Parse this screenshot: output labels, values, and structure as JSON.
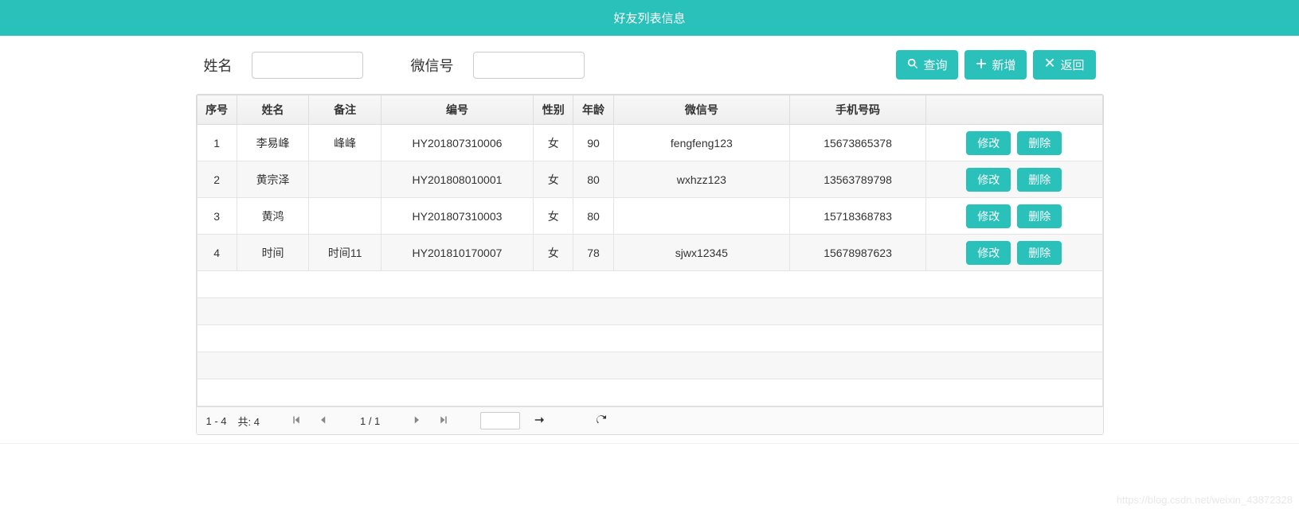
{
  "header": {
    "title": "好友列表信息"
  },
  "search": {
    "name_label": "姓名",
    "name_value": "",
    "wechat_label": "微信号",
    "wechat_value": ""
  },
  "buttons": {
    "query": "查询",
    "add": "新增",
    "back": "返回",
    "edit": "修改",
    "delete": "删除"
  },
  "columns": {
    "seq": "序号",
    "name": "姓名",
    "remark": "备注",
    "code": "编号",
    "gender": "性别",
    "age": "年龄",
    "wechat": "微信号",
    "phone": "手机号码",
    "action": ""
  },
  "rows": [
    {
      "seq": "1",
      "name": "李易峰",
      "remark": "峰峰",
      "code": "HY201807310006",
      "gender": "女",
      "age": "90",
      "wechat": "fengfeng123",
      "phone": "15673865378"
    },
    {
      "seq": "2",
      "name": "黄宗泽",
      "remark": "",
      "code": "HY201808010001",
      "gender": "女",
      "age": "80",
      "wechat": "wxhzz123",
      "phone": "13563789798"
    },
    {
      "seq": "3",
      "name": "黄鸿",
      "remark": "",
      "code": "HY201807310003",
      "gender": "女",
      "age": "80",
      "wechat": "",
      "phone": "15718368783"
    },
    {
      "seq": "4",
      "name": "时间",
      "remark": "时间11",
      "code": "HY201810170007",
      "gender": "女",
      "age": "78",
      "wechat": "sjwx12345",
      "phone": "15678987623"
    }
  ],
  "empty_rows": 5,
  "pager": {
    "range": "1 - 4",
    "total_label": "共: 4",
    "page_info": "1 / 1",
    "goto_value": ""
  },
  "watermark": "https://blog.csdn.net/weixin_43872328"
}
